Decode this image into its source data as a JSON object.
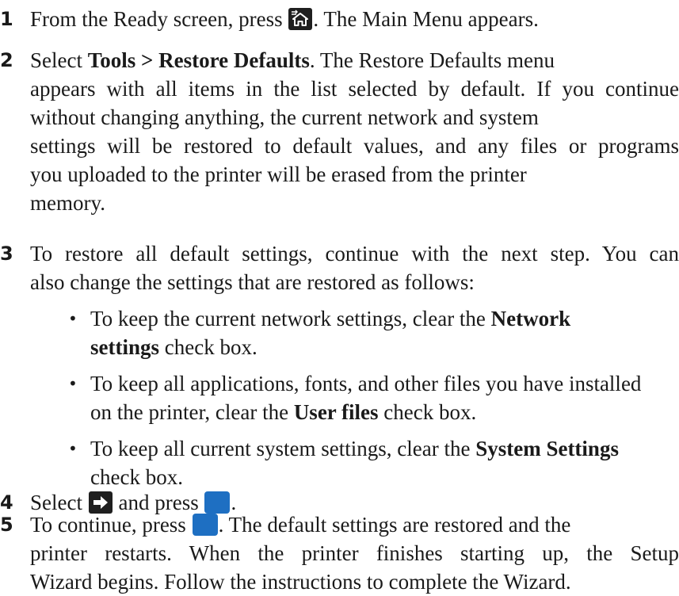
{
  "steps": [
    {
      "num": "1",
      "a": "From the Ready screen, press",
      "b": ". The Main Menu appears.",
      "icon": "home-key-icon"
    },
    {
      "num": "2",
      "lead": "Select",
      "bold": "Tools > Restore Defaults",
      "rest_1": ". The Restore Defaults menu",
      "line_2": "appears with all items in the list selected by default. If you continue",
      "line_3": "without changing anything, the current network and system",
      "line_4": "settings will be restored to default values, and any files or programs",
      "line_5": "you uploaded to the printer will be erased from the printer",
      "line_6": "memory."
    },
    {
      "num": "3",
      "line_1": "To restore all default settings, continue with the next step. You can",
      "line_2": "also change the settings that are restored as follows:",
      "bullets": [
        {
          "pre": "To keep the current network settings, clear the",
          "bold_1": "Network",
          "bold_2": "settings",
          "post": " check box."
        },
        {
          "line_1": "To keep all applications, fonts, and other files you have installed",
          "pre": "on the printer, clear the",
          "bold": "User files",
          "post": " check box."
        },
        {
          "pre": "To keep all current system settings, clear the",
          "bold": "System Settings",
          "line_2": "check box."
        }
      ]
    },
    {
      "num": "4",
      "a": "Select",
      "b": "and press",
      "c": ".",
      "icons": [
        "arrow-key-icon",
        "blue-key-icon"
      ]
    },
    {
      "num": "5",
      "a": "To continue, press",
      "b": ". The default settings are restored and the",
      "line_2": "printer restarts. When the printer finishes starting up, the Setup",
      "line_3": "Wizard begins. Follow the instructions to complete the Wizard.",
      "icon": "blue-key-icon"
    }
  ],
  "colors": {
    "text": "#1a1a1a",
    "icon_dark": "#1f1f1f",
    "blue_key": "#1e6fc2"
  }
}
